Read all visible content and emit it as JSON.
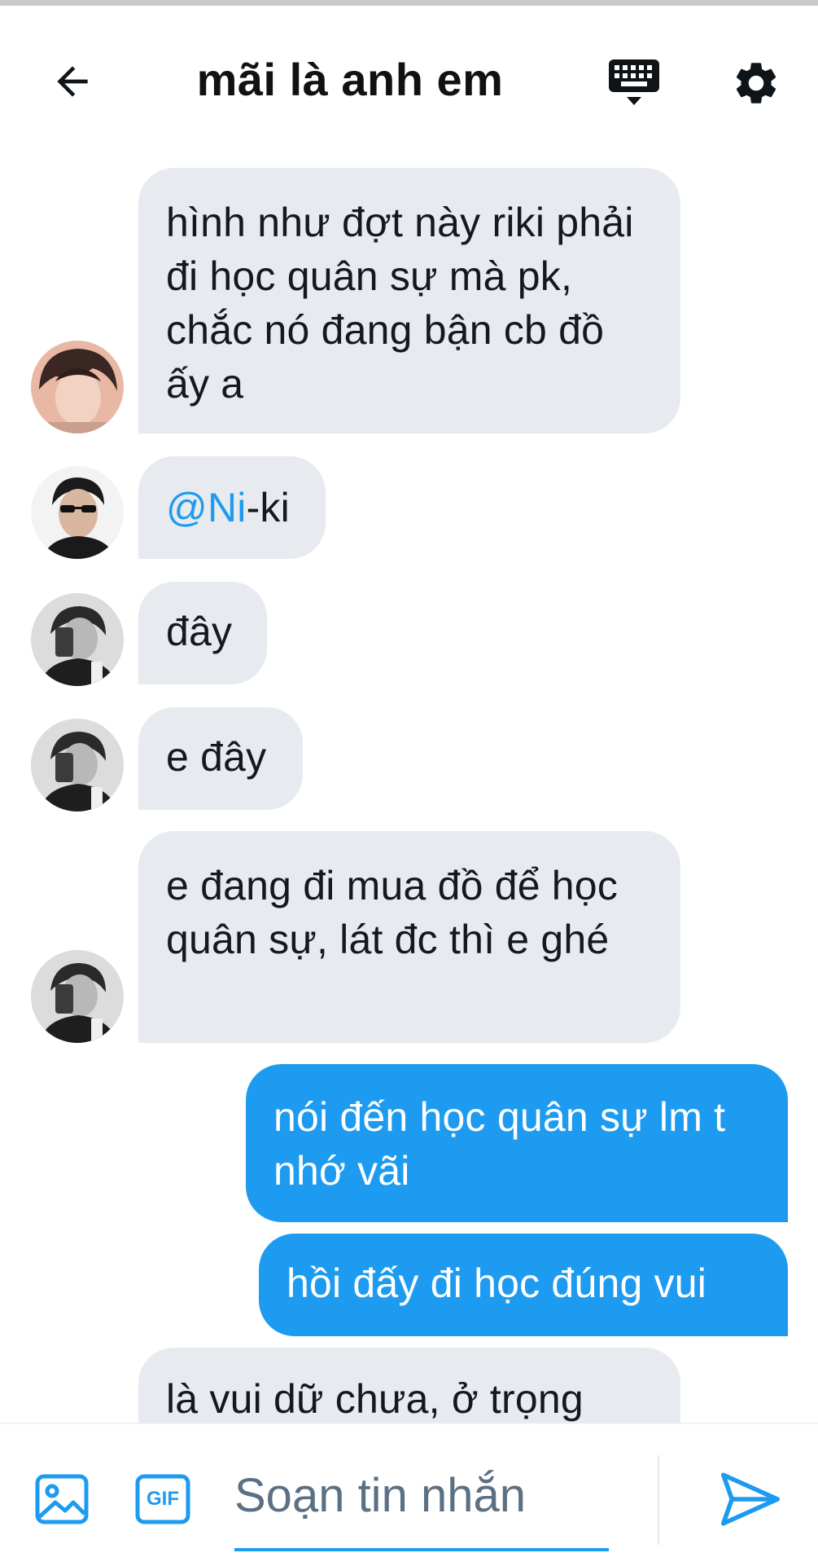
{
  "header": {
    "title": "mãi là anh em"
  },
  "messages": [
    {
      "direction": "in",
      "avatar": "avatar-pink-hair",
      "text": "hình như đợt này riki phải đi học quân sự mà pk, chắc nó đang bận cb đồ ấy a"
    },
    {
      "direction": "in",
      "avatar": "avatar-sunglasses",
      "mention": "@Ni",
      "text_after": "-ki"
    },
    {
      "direction": "in",
      "avatar": "avatar-bw-phone",
      "text": "đây"
    },
    {
      "direction": "in",
      "avatar": "avatar-bw-phone",
      "text": "e đây"
    },
    {
      "direction": "in",
      "avatar": "avatar-bw-phone",
      "text": "e đang đi mua đồ để học quân sự, lát đc thì e ghé"
    },
    {
      "direction": "out",
      "text": "nói đến học quân sự lm t nhớ vãi"
    },
    {
      "direction": "out",
      "text": "hồi đấy đi học đúng vui"
    },
    {
      "direction": "in",
      "avatar": "none",
      "text": "là vui dữ chưa, ở trọng"
    }
  ],
  "composer": {
    "placeholder": "Soạn tin nhắn",
    "gif_label": "GIF"
  },
  "colors": {
    "accent": "#1d9bf0",
    "incoming_bubble": "#e7eaee",
    "text_primary": "#0f1419",
    "placeholder": "#5b7083"
  },
  "icons": [
    "back-arrow-icon",
    "keyboard-icon",
    "gear-icon",
    "image-icon",
    "gif-icon",
    "send-icon"
  ]
}
